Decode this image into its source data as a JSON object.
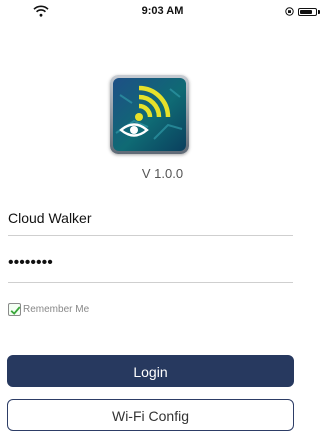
{
  "status_bar": {
    "time": "9:03 AM",
    "icons": [
      "wifi-icon",
      "orientation-lock-icon",
      "battery-icon"
    ]
  },
  "app": {
    "icon": "wifi-eye-app-icon",
    "version": "V 1.0.0"
  },
  "login_form": {
    "username_value": "Cloud Walker",
    "password_masked": "••••••••",
    "remember_label": "Remember Me",
    "remember_checked": true
  },
  "buttons": {
    "login_label": "Login",
    "wifi_config_label": "Wi-Fi Config"
  },
  "colors": {
    "login_button": "#27395f",
    "wifi_config_border": "#2d3d66",
    "checkbox_check": "#3aa63a"
  }
}
